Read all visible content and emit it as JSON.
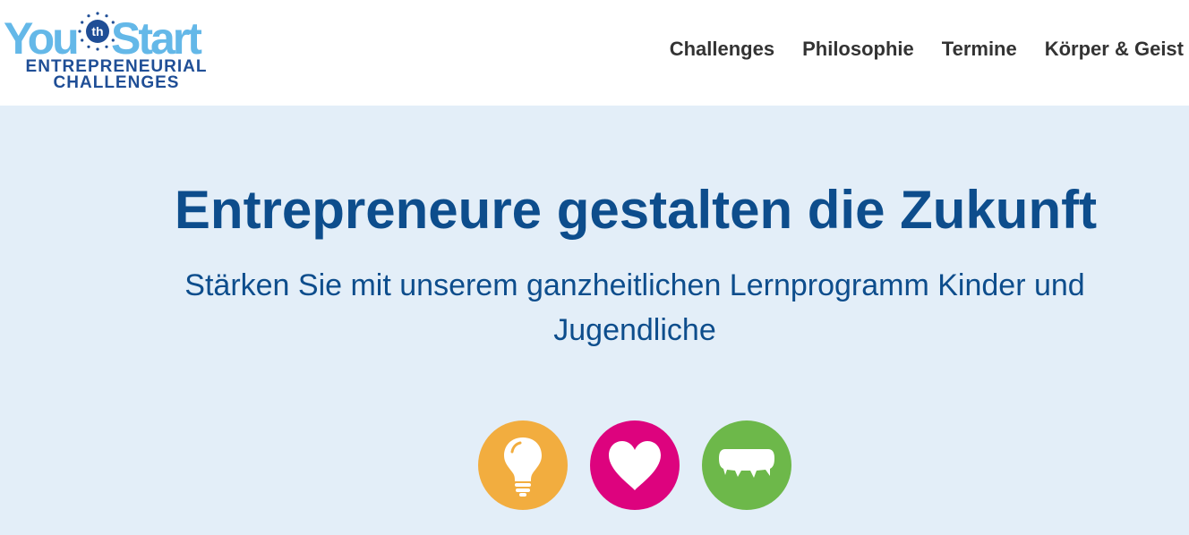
{
  "logo": {
    "word_left": "You",
    "badge": "th",
    "word_right": "Start",
    "line1": "ENTREPRENEURIAL",
    "line2": "CHALLENGES"
  },
  "nav": {
    "items": [
      "Challenges",
      "Philosophie",
      "Termine",
      "Körper & Geist"
    ]
  },
  "hero": {
    "title": "Entrepreneure gestalten die Zukunft",
    "subtitle": "Stärken Sie mit unserem ganzheitlichen Lernprogramm Kinder und Jugendliche"
  },
  "feature_icons": [
    {
      "icon": "lightbulb-icon",
      "color": "#f2ad3f"
    },
    {
      "icon": "heart-icon",
      "color": "#dd037e"
    },
    {
      "icon": "speech-bubble-icon",
      "color": "#6db84a"
    }
  ],
  "colors": {
    "brand_blue": "#0d4d8c",
    "logo_light_blue": "#64b8e8",
    "logo_dark_blue": "#1f4e96",
    "hero_bg": "#e3eef8",
    "nav_text": "#333333"
  }
}
